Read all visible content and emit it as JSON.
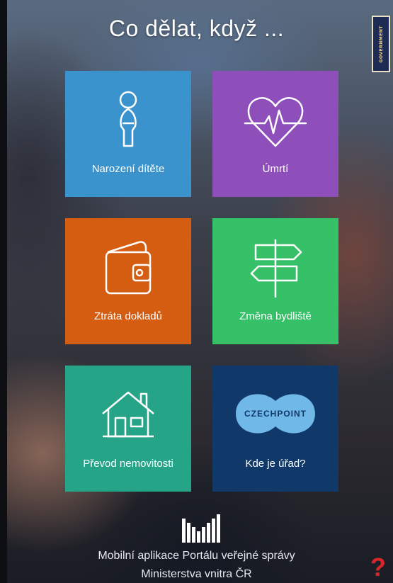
{
  "header": {
    "title": "Co dělat, když ..."
  },
  "badge": {
    "text": "GOVERNMENT"
  },
  "tiles": [
    {
      "label": "Narození dítěte",
      "icon": "child-icon",
      "color": "#3a93cc"
    },
    {
      "label": "Úmrtí",
      "icon": "heart-pulse-icon",
      "color": "#8f4fbb"
    },
    {
      "label": "Ztráta dokladů",
      "icon": "wallet-icon",
      "color": "#d55d12"
    },
    {
      "label": "Změna bydliště",
      "icon": "signpost-icon",
      "color": "#36c067"
    },
    {
      "label": "Převod nemovitosti",
      "icon": "house-icon",
      "color": "#26a488"
    },
    {
      "label": "Kde je úřad?",
      "icon": "czechpoint-logo",
      "color": "#10396a",
      "logo_text": "CZECHPOINT"
    }
  ],
  "footer": {
    "line1": "Mobilní aplikace Portálu veřejné správy",
    "line2": "Ministerstva vnitra ČR"
  },
  "help": {
    "label": "?"
  }
}
